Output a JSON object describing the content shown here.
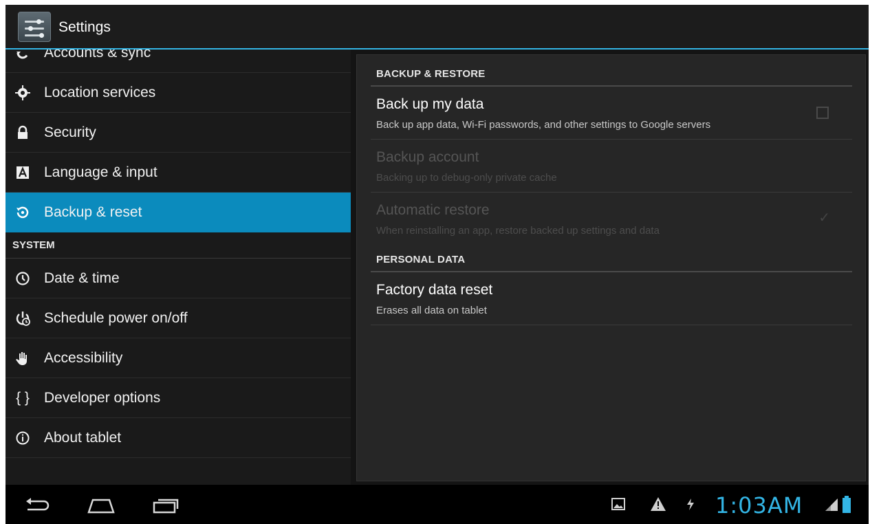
{
  "app": {
    "title": "Settings"
  },
  "sidebar": {
    "items": [
      {
        "label": "Accounts & sync",
        "icon": "sync-icon"
      },
      {
        "label": "Location services",
        "icon": "location-icon"
      },
      {
        "label": "Security",
        "icon": "lock-icon"
      },
      {
        "label": "Language & input",
        "icon": "language-icon"
      },
      {
        "label": "Backup & reset",
        "icon": "backup-icon",
        "active": true
      }
    ],
    "system_header": "SYSTEM",
    "system_items": [
      {
        "label": "Date & time",
        "icon": "clock-icon"
      },
      {
        "label": "Schedule power on/off",
        "icon": "schedule-power-icon"
      },
      {
        "label": "Accessibility",
        "icon": "hand-icon"
      },
      {
        "label": "Developer options",
        "icon": "braces-icon",
        "glyph": "{ }"
      },
      {
        "label": "About tablet",
        "icon": "info-icon"
      }
    ]
  },
  "detail": {
    "backup_header": "BACKUP & RESTORE",
    "backup_my_data": {
      "title": "Back up my data",
      "summary": "Back up app data, Wi-Fi passwords, and other settings to Google servers",
      "checked": false
    },
    "backup_account": {
      "title": "Backup account",
      "summary": "Backing up to debug-only private cache",
      "enabled": false
    },
    "automatic_restore": {
      "title": "Automatic restore",
      "summary": "When reinstalling an app, restore backed up settings and data",
      "checked": true,
      "enabled": false
    },
    "personal_header": "PERSONAL DATA",
    "factory_reset": {
      "title": "Factory data reset",
      "summary": "Erases all data on tablet"
    }
  },
  "navbar": {
    "time": "1:03AM",
    "buttons": [
      "back-icon",
      "home-icon",
      "recent-apps-icon"
    ],
    "status_icons": [
      "screenshot-icon",
      "warning-icon",
      "debug-icon",
      "signal-icon",
      "battery-icon"
    ]
  },
  "colors": {
    "accent": "#33b5e5",
    "active_item": "#0b8bbd",
    "background": "#1a1a1a"
  }
}
